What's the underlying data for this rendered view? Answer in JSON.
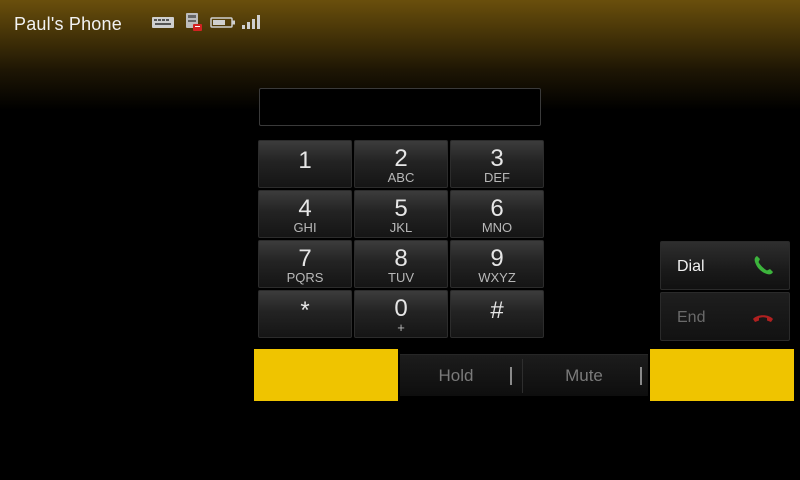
{
  "status_bar": {
    "device_name": "Paul's Phone",
    "icons": [
      "message-icon",
      "phonebook-icon",
      "battery-icon",
      "signal-icon"
    ]
  },
  "display": {
    "number": ""
  },
  "keypad": {
    "keys": [
      {
        "digit": "1",
        "letters": ""
      },
      {
        "digit": "2",
        "letters": "ABC"
      },
      {
        "digit": "3",
        "letters": "DEF"
      },
      {
        "digit": "4",
        "letters": "GHI"
      },
      {
        "digit": "5",
        "letters": "JKL"
      },
      {
        "digit": "6",
        "letters": "MNO"
      },
      {
        "digit": "7",
        "letters": "PQRS"
      },
      {
        "digit": "8",
        "letters": "TUV"
      },
      {
        "digit": "9",
        "letters": "WXYZ"
      },
      {
        "digit": "*",
        "letters": ""
      },
      {
        "digit": "0",
        "letters": "+"
      },
      {
        "digit": "#",
        "letters": ""
      }
    ]
  },
  "call_controls": {
    "dial_label": "Dial",
    "end_label": "End"
  },
  "actions": {
    "hold_label": "Hold",
    "mute_label": "Mute"
  },
  "colors": {
    "accent_yellow": "#efc400",
    "dial_green": "#3cb43c",
    "end_red": "#b02020"
  }
}
